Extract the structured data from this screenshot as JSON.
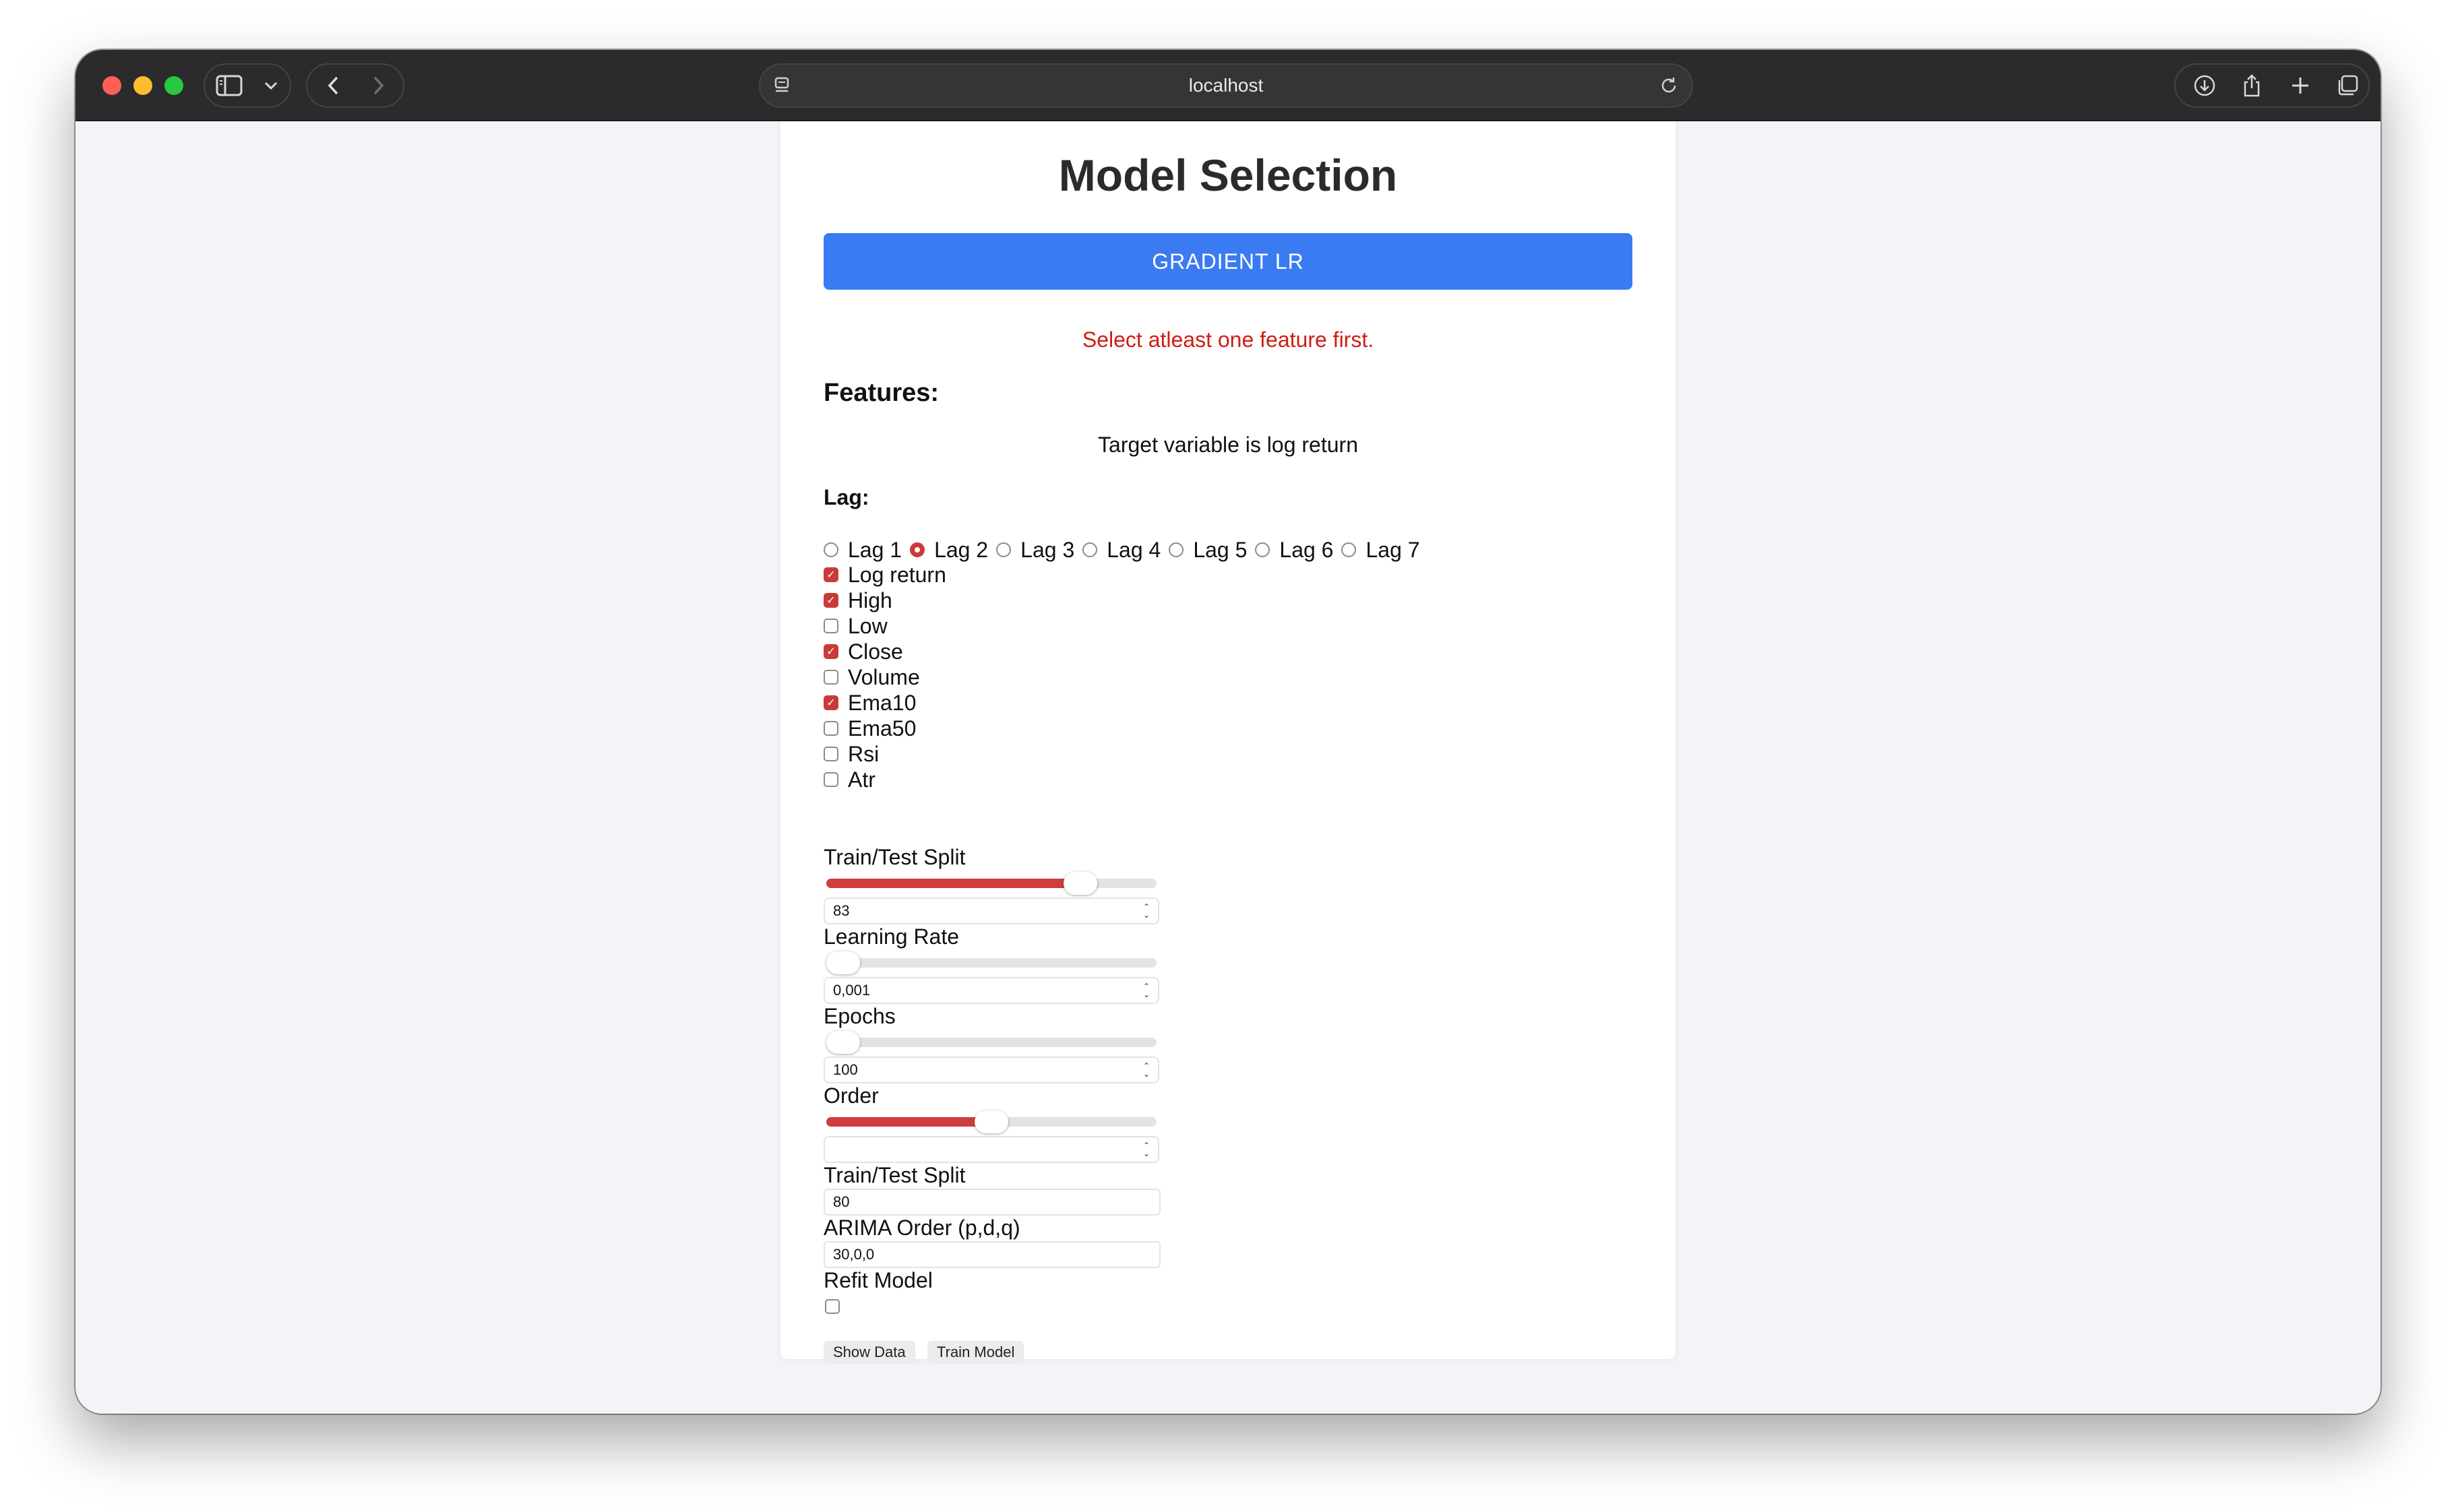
{
  "browser": {
    "url": "localhost"
  },
  "page": {
    "title": "Model Selection",
    "model_button": "GRADIENT LR",
    "error": "Select atleast one feature first.",
    "features_heading": "Features:",
    "target_text": "Target variable is log return",
    "lag_heading": "Lag:",
    "lags": [
      {
        "label": "Lag 1",
        "selected": false
      },
      {
        "label": "Lag 2",
        "selected": true
      },
      {
        "label": "Lag 3",
        "selected": false
      },
      {
        "label": "Lag 4",
        "selected": false
      },
      {
        "label": "Lag 5",
        "selected": false
      },
      {
        "label": "Lag 6",
        "selected": false
      },
      {
        "label": "Lag 7",
        "selected": false
      }
    ],
    "features": [
      {
        "label": "Log return",
        "checked": true
      },
      {
        "label": "High",
        "checked": true
      },
      {
        "label": "Low",
        "checked": false
      },
      {
        "label": "Close",
        "checked": true
      },
      {
        "label": "Volume",
        "checked": false
      },
      {
        "label": "Ema10",
        "checked": true
      },
      {
        "label": "Ema50",
        "checked": false
      },
      {
        "label": "Rsi",
        "checked": false
      },
      {
        "label": "Atr",
        "checked": false
      }
    ],
    "params": {
      "split": {
        "label": "Train/Test Split",
        "value": "83",
        "slider_fraction": 0.8
      },
      "lr": {
        "label": "Learning Rate",
        "value": "0,001",
        "slider_fraction": 0.0
      },
      "epochs": {
        "label": "Epochs",
        "value": "100",
        "slider_fraction": 0.0
      },
      "order": {
        "label": "Order",
        "value": "",
        "slider_fraction": 0.5
      }
    },
    "arima": {
      "split_label": "Train/Test Split",
      "split_value": "80",
      "order_label": "ARIMA Order (p,d,q)",
      "order_value": "30,0,0",
      "refit_label": "Refit Model",
      "refit_checked": false
    },
    "buttons": {
      "show_data": "Show Data",
      "train_model": "Train Model"
    }
  },
  "colors": {
    "accent_blue": "#3b7bf2",
    "error_red": "#cf1d13",
    "checked_red": "#c93b3b"
  }
}
